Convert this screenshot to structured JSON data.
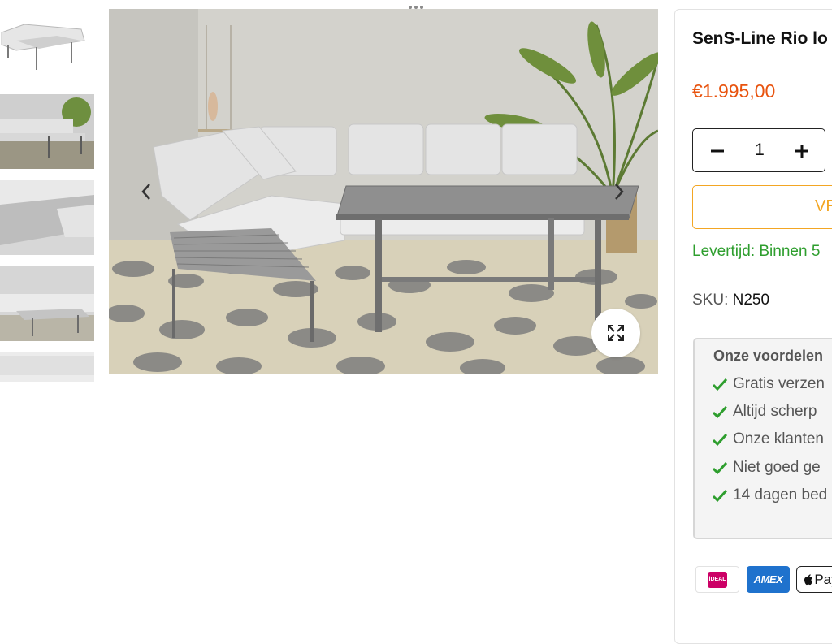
{
  "product": {
    "title": "SenS-Line Rio lo",
    "price": "€1.995,00",
    "quantity": "1",
    "add_to_cart_label": "VR",
    "delivery_text": "Levertijd: Binnen 5",
    "sku_label": "SKU:",
    "sku_value": "N250"
  },
  "benefits": {
    "title": "Onze voordelen",
    "items": [
      {
        "label": "Gratis verzen"
      },
      {
        "label": "Altijd scherp"
      },
      {
        "label": "Onze klanten"
      },
      {
        "label": "Niet goed ge"
      },
      {
        "label": "14 dagen bed"
      }
    ]
  },
  "payment": {
    "ideal_label": "iDEAL",
    "amex_label": "AMEX",
    "apple_label": "Pay"
  },
  "colors": {
    "price": "#e8530e",
    "accent_button": "#f3a623",
    "delivery_green": "#2e9e2e",
    "check_green": "#2e9e2e"
  },
  "icons": {
    "more": "more-dots-icon",
    "prev": "chevron-left-icon",
    "next": "chevron-right-icon",
    "zoom": "expand-icon",
    "minus": "minus-icon",
    "plus": "plus-icon",
    "check": "check-icon"
  }
}
